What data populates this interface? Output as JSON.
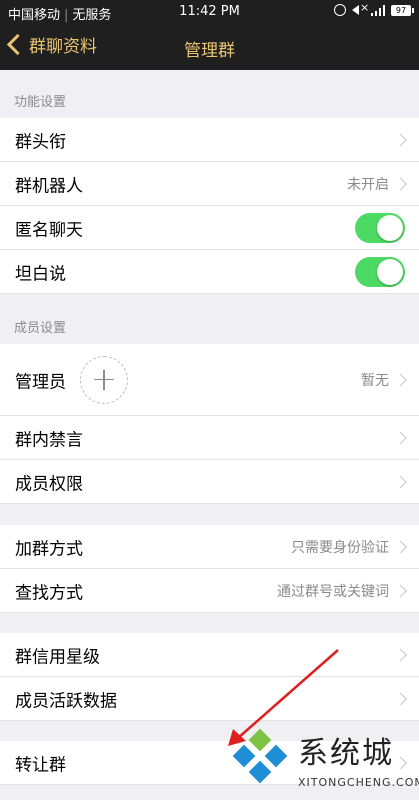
{
  "status_bar": {
    "carrier": "中国移动",
    "service": "无服务",
    "time": "11:42 PM",
    "battery": "97"
  },
  "nav": {
    "back_label": "群聊资料",
    "title": "管理群"
  },
  "sections": {
    "function_header": "功能设置",
    "member_header": "成员设置"
  },
  "rows": {
    "title": {
      "label": "群头衔"
    },
    "robot": {
      "label": "群机器人",
      "value": "未开启"
    },
    "anonymous": {
      "label": "匿名聊天",
      "toggle_on": true
    },
    "frank": {
      "label": "坦白说",
      "toggle_on": true
    },
    "admin": {
      "label": "管理员",
      "value": "暂无"
    },
    "mute": {
      "label": "群内禁言"
    },
    "permissions": {
      "label": "成员权限"
    },
    "join": {
      "label": "加群方式",
      "value": "只需要身份验证"
    },
    "find": {
      "label": "查找方式",
      "value": "通过群号或关键词"
    },
    "credit": {
      "label": "群信用星级"
    },
    "activity": {
      "label": "成员活跃数据"
    },
    "transfer": {
      "label": "转让群"
    }
  },
  "watermark": {
    "text": "系统城",
    "sub": "XITONGCHENG.COM"
  },
  "colors": {
    "accent": "#e8c471",
    "toggle_on": "#4cd964",
    "arrow": "#e02020"
  }
}
